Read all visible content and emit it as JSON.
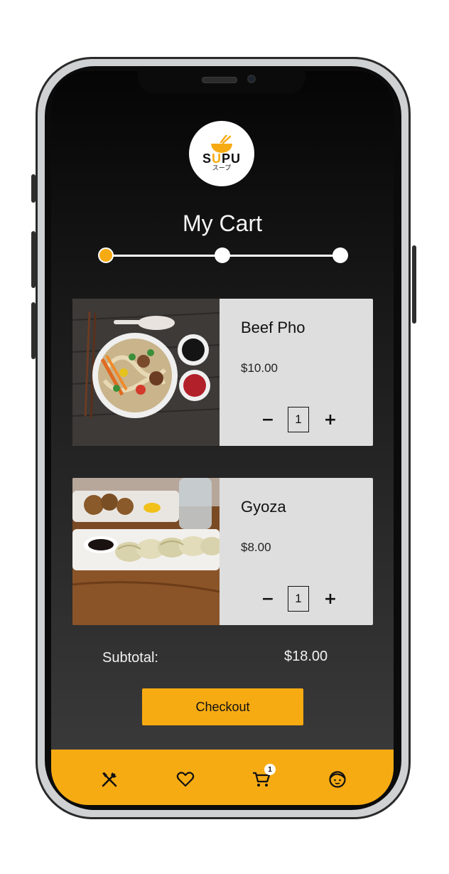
{
  "brand": {
    "logo_word_start": "S",
    "logo_word_highlight": "U",
    "logo_word_end": "PU",
    "logo_subtitle": "スープ",
    "accent_color": "#f7ab13"
  },
  "page": {
    "title": "My Cart"
  },
  "checkout_progress": {
    "steps": 3,
    "current_step": 1
  },
  "cart": {
    "items": [
      {
        "name": "Beef Pho",
        "price": "$10.00",
        "quantity": "1",
        "decrease_symbol": "−",
        "increase_symbol": "+",
        "image": "beef-pho-bowl-photo"
      },
      {
        "name": "Gyoza",
        "price": "$8.00",
        "quantity": "1",
        "decrease_symbol": "−",
        "increase_symbol": "+",
        "image": "gyoza-plate-photo"
      }
    ],
    "subtotal_label": "Subtotal:",
    "subtotal_value": "$18.00"
  },
  "checkout_label": "Checkout",
  "bottom_nav": {
    "items": [
      {
        "icon": "fork-knife-icon"
      },
      {
        "icon": "heart-icon"
      },
      {
        "icon": "cart-icon",
        "badge": "1"
      },
      {
        "icon": "profile-face-icon"
      }
    ]
  }
}
